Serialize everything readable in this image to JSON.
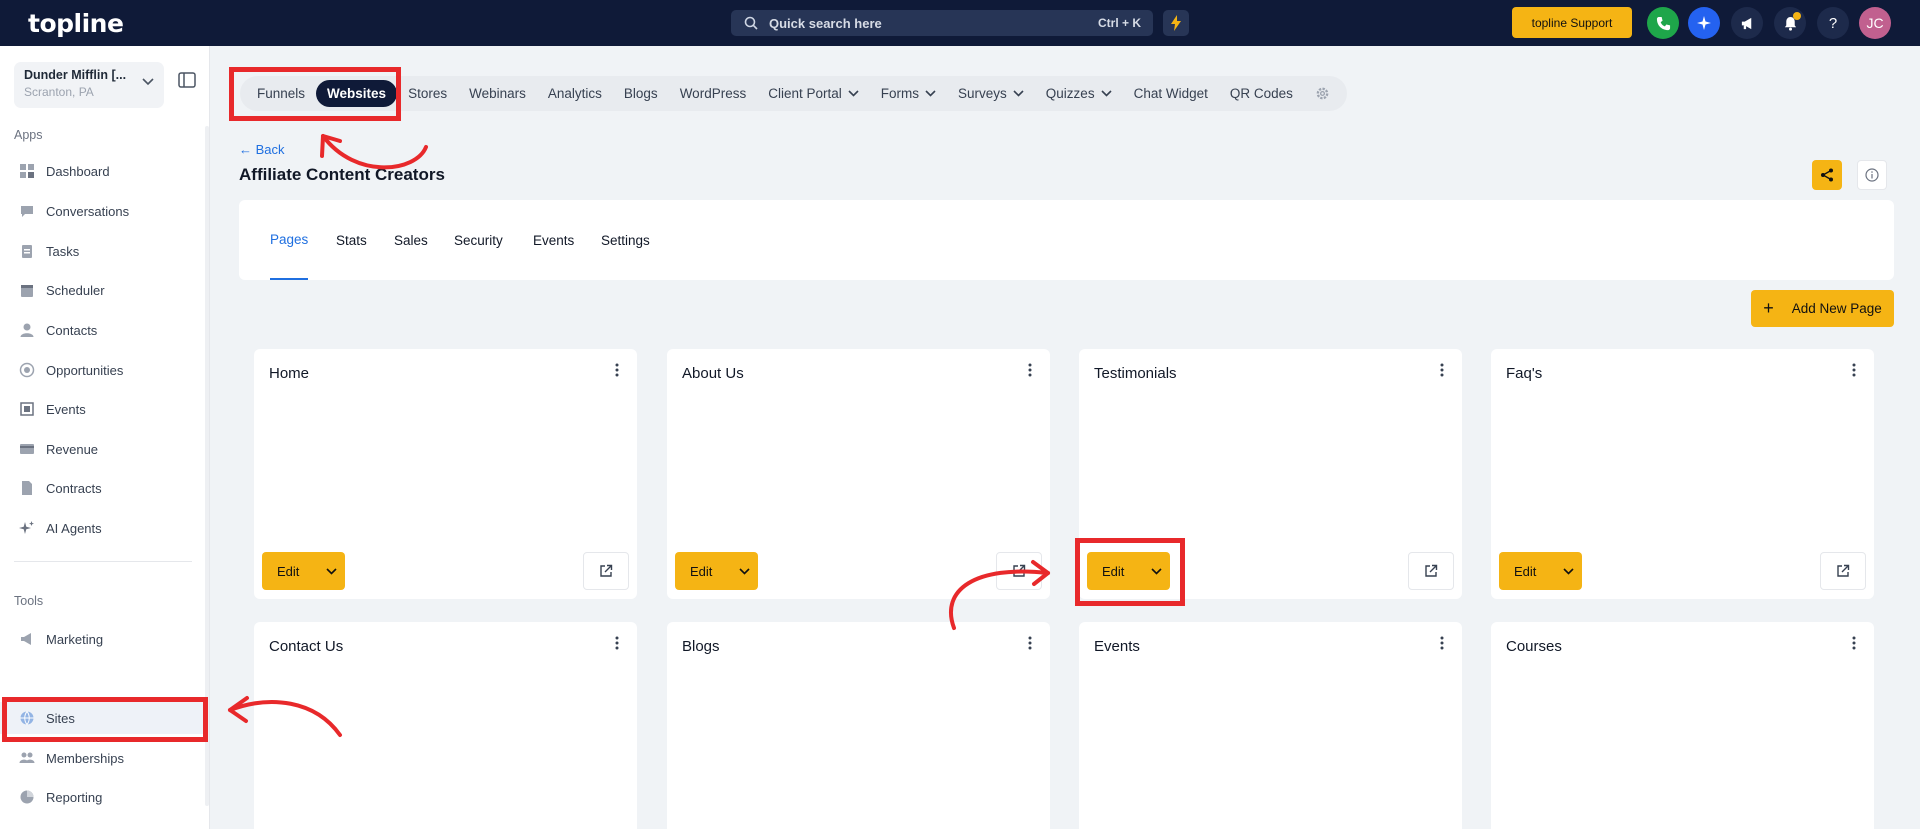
{
  "topbar": {
    "logo": "topline",
    "search_label": "Quick search here",
    "search_shortcut": "Ctrl + K",
    "support_label": "topline Support",
    "avatar_initials": "JC"
  },
  "sidebar": {
    "account_name": "Dunder Mifflin [...",
    "account_location": "Scranton, PA",
    "apps_label": "Apps",
    "tools_label": "Tools",
    "apps": [
      {
        "label": "Dashboard"
      },
      {
        "label": "Conversations"
      },
      {
        "label": "Tasks"
      },
      {
        "label": "Scheduler"
      },
      {
        "label": "Contacts"
      },
      {
        "label": "Opportunities"
      },
      {
        "label": "Events"
      },
      {
        "label": "Revenue"
      },
      {
        "label": "Contracts"
      },
      {
        "label": "AI Agents"
      }
    ],
    "tools": [
      {
        "label": "Marketing"
      },
      {
        "label": "Sites"
      },
      {
        "label": "Memberships"
      },
      {
        "label": "Reporting"
      }
    ]
  },
  "subnav": {
    "items": [
      "Funnels",
      "Websites",
      "Stores",
      "Webinars",
      "Analytics",
      "Blogs",
      "WordPress",
      "Client Portal",
      "Forms",
      "Surveys",
      "Quizzes",
      "Chat Widget",
      "QR Codes"
    ],
    "active": "Websites"
  },
  "header": {
    "back_label": "Back",
    "title": "Affiliate Content Creators"
  },
  "tabs": {
    "items": [
      "Pages",
      "Stats",
      "Sales",
      "Security",
      "Events",
      "Settings"
    ],
    "active": "Pages"
  },
  "add_page_label": "Add New Page",
  "edit_label": "Edit",
  "pages": [
    {
      "title": "Home"
    },
    {
      "title": "About Us"
    },
    {
      "title": "Testimonials"
    },
    {
      "title": "Faq's"
    },
    {
      "title": "Contact Us"
    },
    {
      "title": "Blogs"
    },
    {
      "title": "Events"
    },
    {
      "title": "Courses"
    }
  ],
  "colors": {
    "topbar": "#0f1a38",
    "accent": "#f5b414",
    "link": "#1f6fe0",
    "annotation": "#e8292b"
  }
}
